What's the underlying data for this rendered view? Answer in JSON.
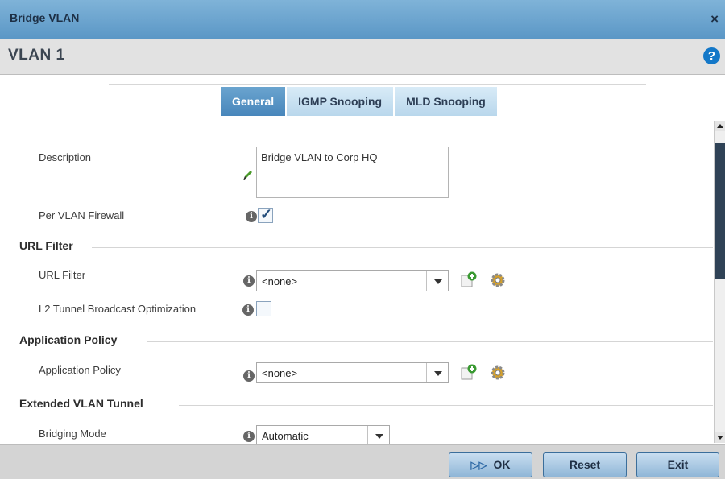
{
  "dialog": {
    "title": "Bridge VLAN",
    "close_symbol": "×",
    "heading": "VLAN  1",
    "help_symbol": "?"
  },
  "tabs": [
    {
      "label": "General",
      "active": true
    },
    {
      "label": "IGMP Snooping",
      "active": false
    },
    {
      "label": "MLD Snooping",
      "active": false
    }
  ],
  "general": {
    "description_label": "Description",
    "description_value": "Bridge VLAN to Corp HQ",
    "per_vlan_firewall_label": "Per VLAN Firewall",
    "per_vlan_firewall_checked": true,
    "url_filter_section": "URL Filter",
    "url_filter_label": "URL Filter",
    "url_filter_value": "<none>",
    "l2_tunnel_label": "L2 Tunnel Broadcast Optimization",
    "l2_tunnel_checked": false,
    "app_policy_section": "Application Policy",
    "app_policy_label": "Application Policy",
    "app_policy_value": "<none>",
    "ext_vlan_section": "Extended VLAN Tunnel",
    "bridging_mode_label": "Bridging Mode",
    "bridging_mode_value": "Automatic"
  },
  "footer": {
    "ok_label": "OK",
    "reset_label": "Reset",
    "exit_label": "Exit"
  },
  "colors": {
    "titlebar": "#5b97c6",
    "tab_active": "#4886bb",
    "tab_inactive": "#c4def1",
    "help_icon": "#1478c8",
    "scroll_thumb": "#2f4256"
  }
}
